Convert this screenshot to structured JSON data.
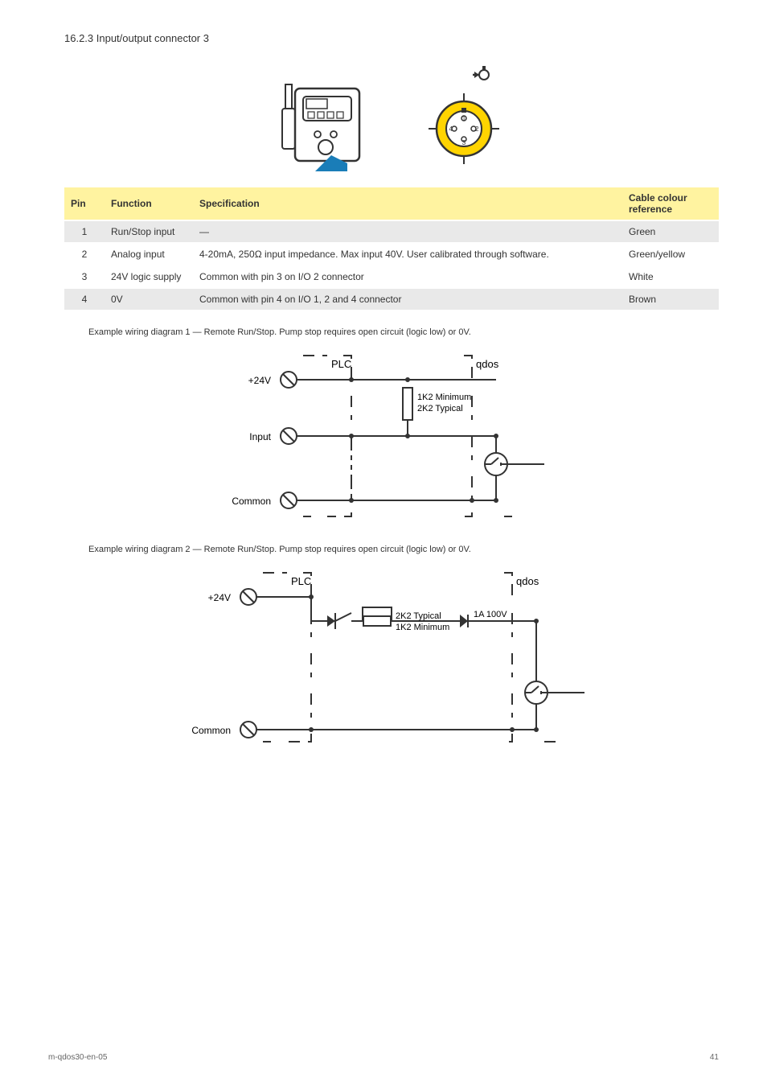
{
  "section": {
    "title": "16.2.3  Input/output connector 3"
  },
  "table": {
    "headers": {
      "pin": "Pin",
      "function": "Function",
      "spec": "Specification",
      "cable": "Cable colour reference"
    },
    "rows": [
      {
        "pin": "1",
        "func": "Run/Stop input",
        "spec": "—",
        "cable": "Green"
      },
      {
        "pin": "2",
        "func": "Analog input",
        "spec": "4-20mA, 250Ω input impedance. Max input 40V. User calibrated through software.",
        "cable": "Green/yellow"
      },
      {
        "pin": "3",
        "func": "24V logic supply",
        "spec": "Common with pin 3 on I/O 2 connector",
        "cable": "White"
      },
      {
        "pin": "4",
        "func": "0V",
        "spec": "Common with pin 4 on I/O 1, 2 and 4 connector",
        "cable": "Brown"
      }
    ]
  },
  "captions": {
    "cap1": "Example wiring diagram 1 — Remote Run/Stop. Pump stop requires open circuit (logic low) or 0V.",
    "cap2": "Example wiring diagram 2 — Remote Run/Stop. Pump stop requires open circuit (logic low) or 0V."
  },
  "circuit1": {
    "plc": "PLC",
    "qdos": "qdos",
    "v24": "+24V",
    "input": "Input",
    "common": "Common",
    "r1": "1K2 Minimum",
    "r2": "2K2 Typical"
  },
  "circuit2": {
    "plc": "PLC",
    "qdos": "qdos",
    "v24": "+24V",
    "common": "Common",
    "r1": "2K2 Typical",
    "r2": "1K2 Minimum",
    "diode": "1A 100V"
  },
  "footer": {
    "left": "m-qdos30-en-05",
    "right": "41"
  }
}
